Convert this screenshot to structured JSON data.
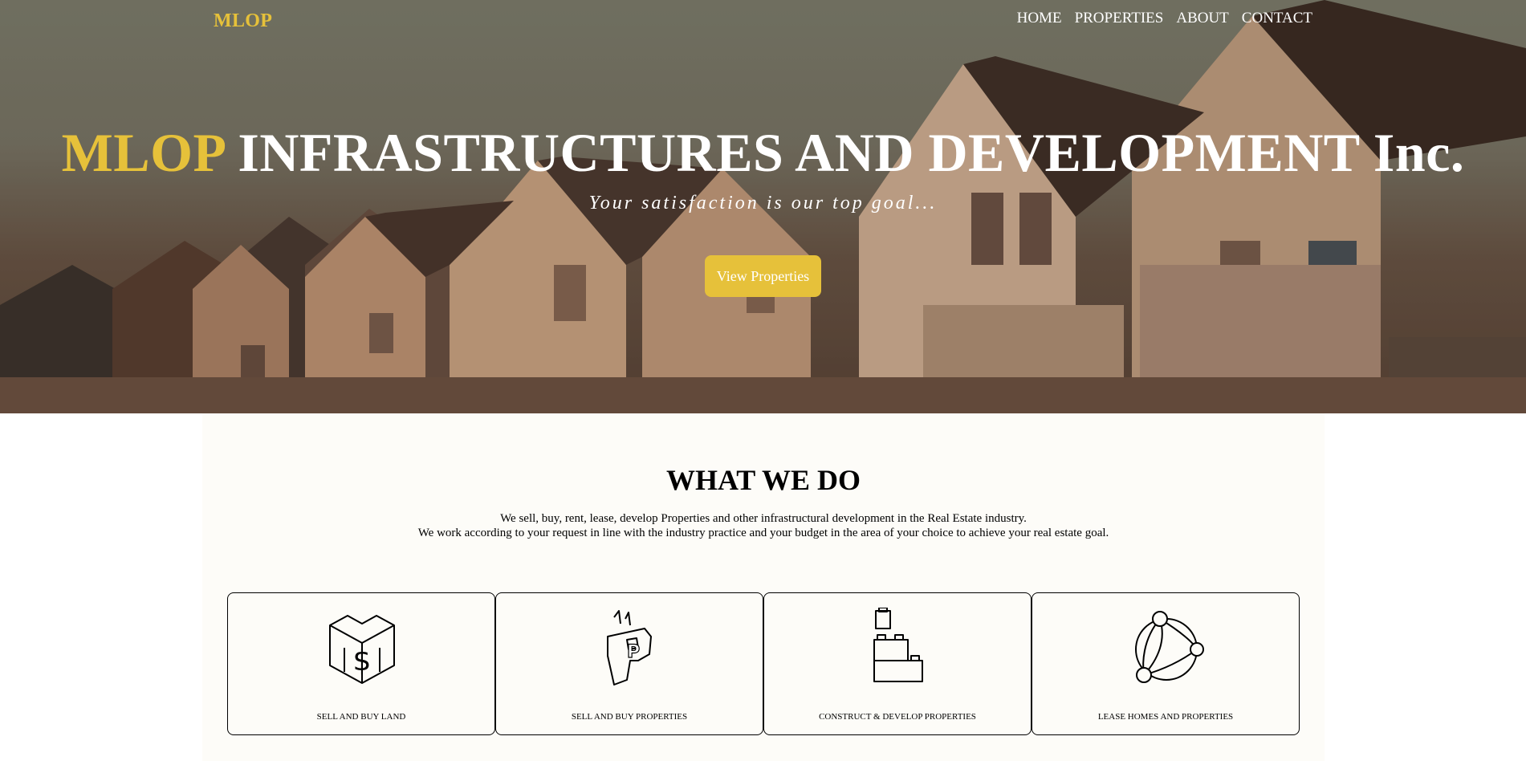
{
  "nav": {
    "logo": "MLOP",
    "links": [
      "HOME",
      "PROPERTIES",
      "ABOUT",
      "CONTACT"
    ]
  },
  "hero": {
    "title_brand": "MLOP",
    "title_rest": "INFRASTRUCTURES AND DEVELOPMENT Inc.",
    "tagline": "Your satisfaction is our top goal...",
    "button_label": "View Properties"
  },
  "what_we_do": {
    "title": "WHAT WE DO",
    "description_line1": "We sell, buy, rent, lease, develop Properties and other infrastructural development in the Real Estate industry.",
    "description_line2": "We work according to your request in line with the industry practice and your budget in the area of your choice to achieve your real estate goal.",
    "cards": [
      {
        "label": "SELL AND BUY LAND",
        "icon": "money-box-icon"
      },
      {
        "label": "SELL AND BUY PROPERTIES",
        "icon": "property-p-icon"
      },
      {
        "label": "CONSTRUCT & DEVELOP PROPERTIES",
        "icon": "building-blocks-icon"
      },
      {
        "label": "LEASE HOMES AND PROPERTIES",
        "icon": "network-globe-icon"
      }
    ]
  },
  "colors": {
    "accent": "#e6c13a",
    "section_bg": "#fdfcf8",
    "text": "#000000",
    "hero_text": "#ffffff"
  }
}
